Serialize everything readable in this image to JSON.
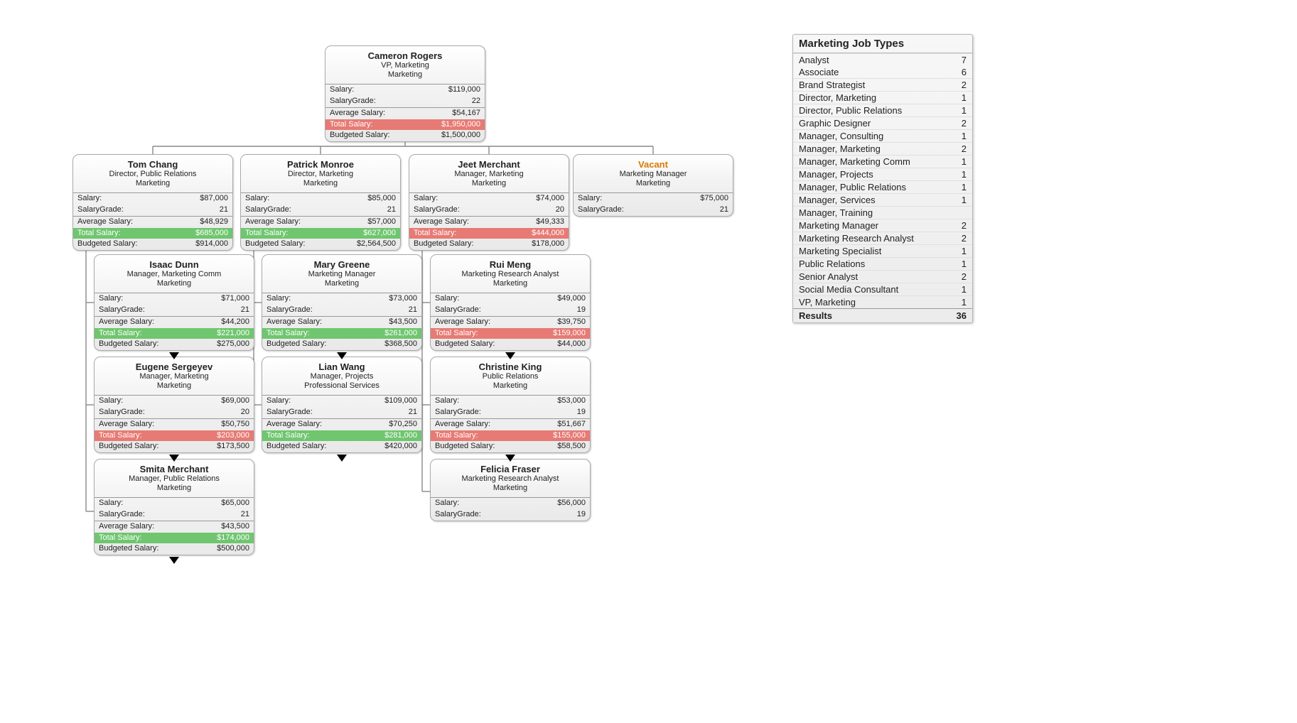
{
  "labels": {
    "salary": "Salary:",
    "grade": "SalaryGrade:",
    "avg": "Average Salary:",
    "total": "Total Salary:",
    "budget": "Budgeted Salary:"
  },
  "panel": {
    "title": "Marketing Job Types",
    "results_label": "Results",
    "rows": [
      {
        "label": "Analyst",
        "count": "7"
      },
      {
        "label": "Associate",
        "count": "6"
      },
      {
        "label": "Brand Strategist",
        "count": "2"
      },
      {
        "label": "Director, Marketing",
        "count": "1"
      },
      {
        "label": "Director, Public Relations",
        "count": "1"
      },
      {
        "label": "Graphic Designer",
        "count": "2"
      },
      {
        "label": "Manager, Consulting",
        "count": "1"
      },
      {
        "label": "Manager, Marketing",
        "count": "2"
      },
      {
        "label": "Manager, Marketing Comm",
        "count": "1"
      },
      {
        "label": "Manager, Projects",
        "count": "1"
      },
      {
        "label": "Manager, Public Relations",
        "count": "1"
      },
      {
        "label": "Manager, Services",
        "count": "1"
      },
      {
        "label": "Manager, Training",
        "count": ""
      },
      {
        "label": "Marketing Manager",
        "count": "2"
      },
      {
        "label": "Marketing Research Analyst",
        "count": "2"
      },
      {
        "label": "Marketing Specialist",
        "count": "1"
      },
      {
        "label": "Public Relations",
        "count": "1"
      },
      {
        "label": "Senior Analyst",
        "count": "2"
      },
      {
        "label": "Social Media Consultant",
        "count": "1"
      },
      {
        "label": "VP, Marketing",
        "count": "1"
      }
    ],
    "results_count": "36"
  },
  "root": {
    "name": "Cameron Rogers",
    "title": "VP, Marketing",
    "dept": "Marketing",
    "salary": "$119,000",
    "grade": "22",
    "avg": "$54,167",
    "total": "$1,950,000",
    "total_status": "red",
    "budget": "$1,500,000"
  },
  "level2": [
    {
      "id": "tom",
      "name": "Tom Chang",
      "title": "Director, Public Relations",
      "dept": "Marketing",
      "salary": "$87,000",
      "grade": "21",
      "avg": "$48,929",
      "total": "$685,000",
      "total_status": "green",
      "budget": "$914,000"
    },
    {
      "id": "patrick",
      "name": "Patrick Monroe",
      "title": "Director, Marketing",
      "dept": "Marketing",
      "salary": "$85,000",
      "grade": "21",
      "avg": "$57,000",
      "total": "$627,000",
      "total_status": "green",
      "budget": "$2,564,500"
    },
    {
      "id": "jeet",
      "name": "Jeet Merchant",
      "title": "Manager, Marketing",
      "dept": "Marketing",
      "salary": "$74,000",
      "grade": "20",
      "avg": "$49,333",
      "total": "$444,000",
      "total_status": "red",
      "budget": "$178,000"
    },
    {
      "id": "vacant",
      "vacant": true,
      "name": "Vacant",
      "title": "Marketing Manager",
      "dept": "Marketing",
      "salary": "$75,000",
      "grade": "21"
    }
  ],
  "col1": [
    {
      "name": "Isaac Dunn",
      "title": "Manager, Marketing Comm",
      "dept": "Marketing",
      "salary": "$71,000",
      "grade": "21",
      "avg": "$44,200",
      "total": "$221,000",
      "total_status": "green",
      "budget": "$275,000",
      "tri": true
    },
    {
      "name": "Eugene Sergeyev",
      "title": "Manager, Marketing",
      "dept": "Marketing",
      "salary": "$69,000",
      "grade": "20",
      "avg": "$50,750",
      "total": "$203,000",
      "total_status": "red",
      "budget": "$173,500",
      "tri": true
    },
    {
      "name": "Smita Merchant",
      "title": "Manager, Public Relations",
      "dept": "Marketing",
      "salary": "$65,000",
      "grade": "21",
      "avg": "$43,500",
      "total": "$174,000",
      "total_status": "green",
      "budget": "$500,000",
      "tri": true
    }
  ],
  "col2": [
    {
      "name": "Mary Greene",
      "title": "Marketing Manager",
      "dept": "Marketing",
      "salary": "$73,000",
      "grade": "21",
      "avg": "$43,500",
      "total": "$261,000",
      "total_status": "green",
      "budget": "$368,500",
      "tri": true
    },
    {
      "name": "Lian Wang",
      "title": "Manager, Projects",
      "dept": "Professional Services",
      "salary": "$109,000",
      "grade": "21",
      "avg": "$70,250",
      "total": "$281,000",
      "total_status": "green",
      "budget": "$420,000",
      "tri": true
    }
  ],
  "col3": [
    {
      "name": "Rui Meng",
      "title": "Marketing Research Analyst",
      "dept": "Marketing",
      "salary": "$49,000",
      "grade": "19",
      "avg": "$39,750",
      "total": "$159,000",
      "total_status": "red",
      "budget": "$44,000",
      "tri": true
    },
    {
      "name": "Christine King",
      "title": "Public Relations",
      "dept": "Marketing",
      "salary": "$53,000",
      "grade": "19",
      "avg": "$51,667",
      "total": "$155,000",
      "total_status": "red",
      "budget": "$58,500",
      "tri": true
    },
    {
      "name": "Felicia Fraser",
      "title": "Marketing Research Analyst",
      "dept": "Marketing",
      "salary": "$56,000",
      "grade": "19"
    }
  ]
}
